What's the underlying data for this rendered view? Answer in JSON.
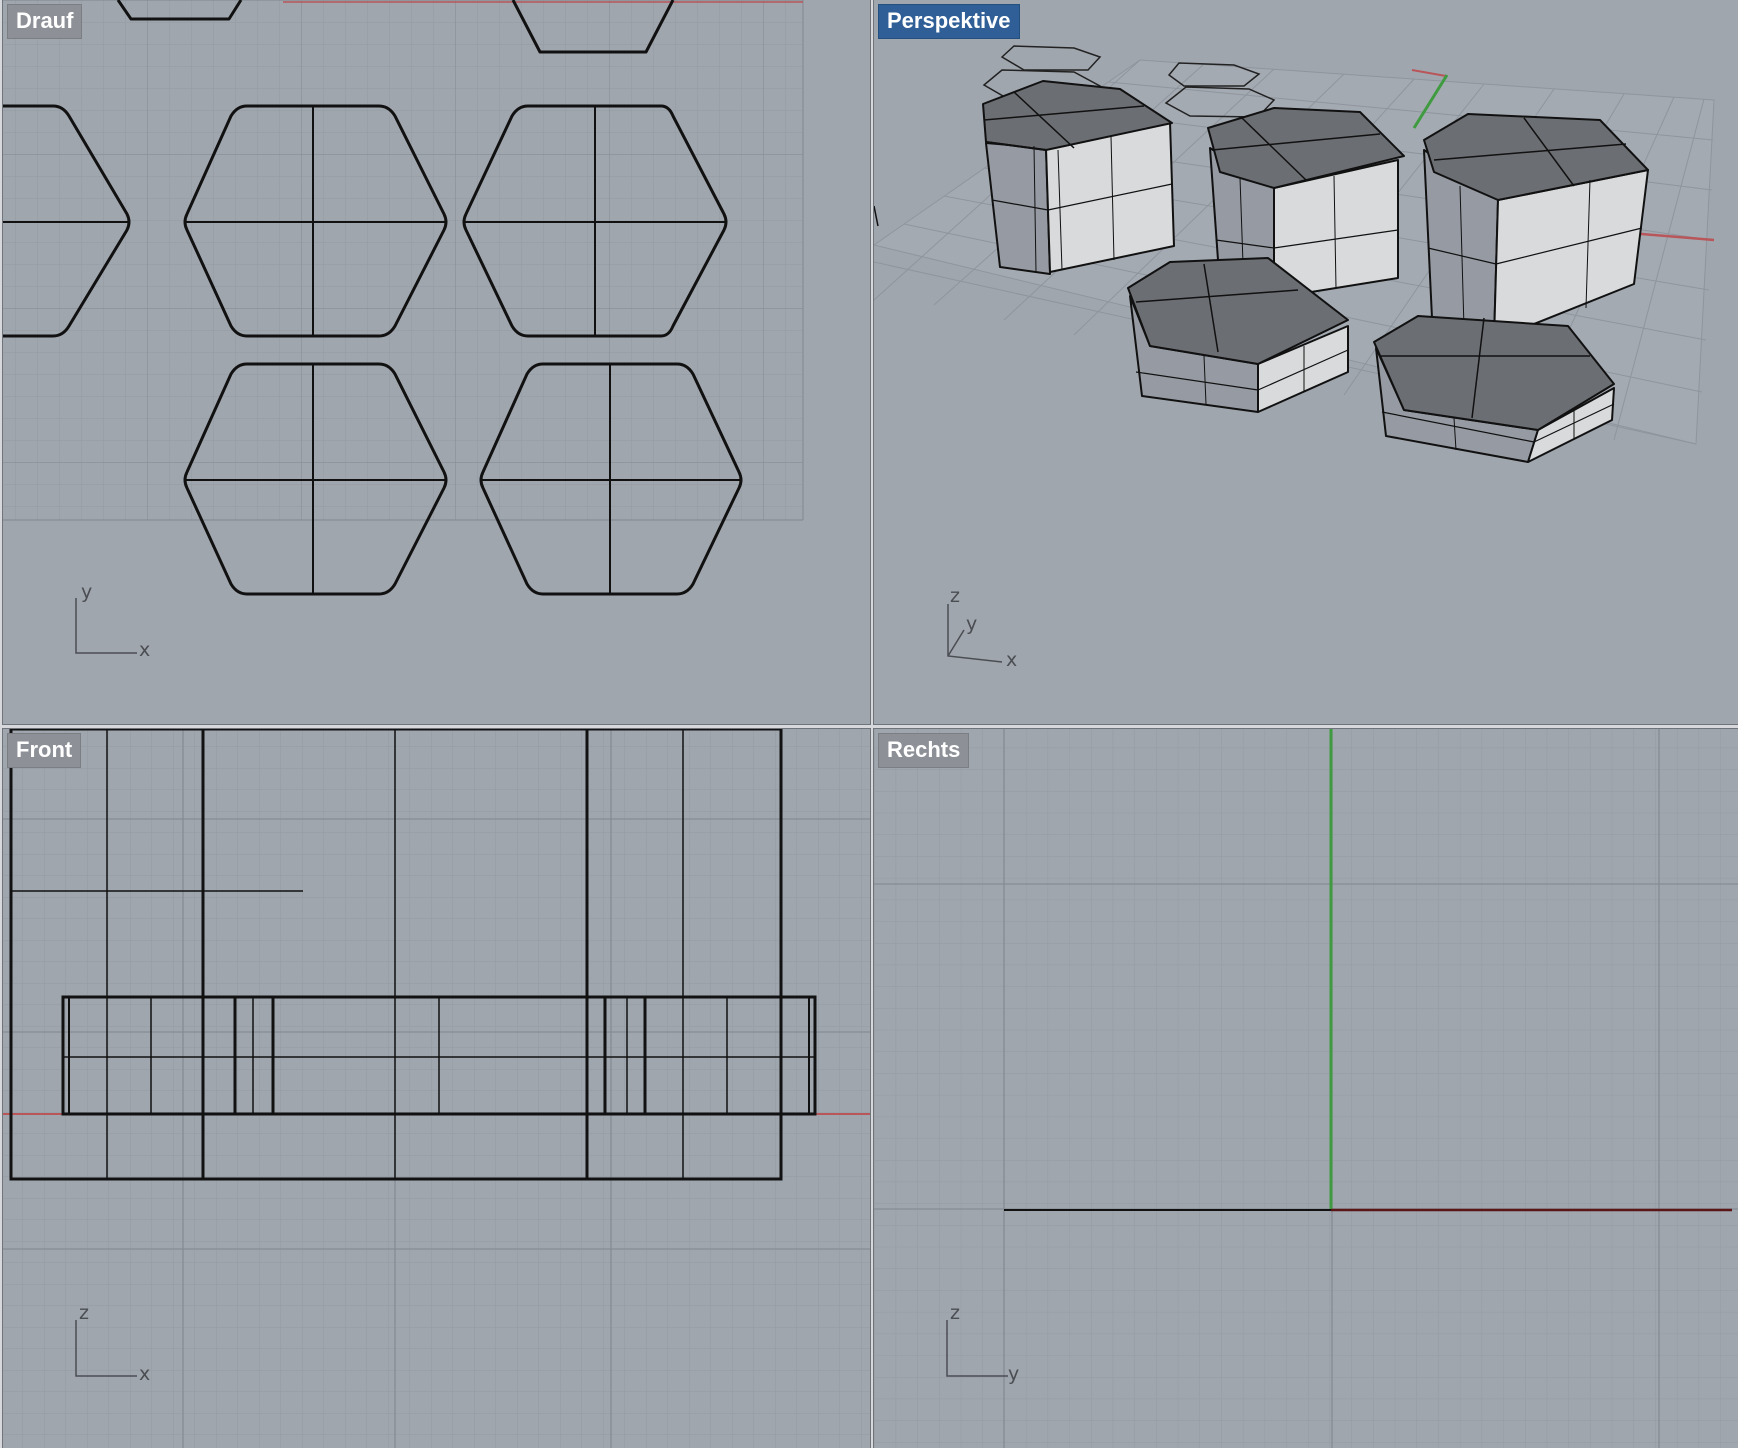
{
  "viewports": {
    "top": {
      "label": "Drauf",
      "axis_labels": [
        "y",
        "x"
      ],
      "active": false
    },
    "persp": {
      "label": "Perspektive",
      "axis_labels": [
        "z",
        "y",
        "x"
      ],
      "active": true
    },
    "front": {
      "label": "Front",
      "axis_labels": [
        "z",
        "x"
      ],
      "active": false
    },
    "right": {
      "label": "Rechts",
      "axis_labels": [
        "z",
        "y"
      ],
      "active": false
    }
  },
  "colors": {
    "viewport_bg": "#a0a6ae",
    "grid_minor": "#959ba3",
    "grid_major": "#868c94",
    "x_axis": "#b8565a",
    "y_axis": "#3f9b3f",
    "wire": "#111111",
    "active_title": "#2f5f96",
    "inactive_title": "#8d9197"
  }
}
